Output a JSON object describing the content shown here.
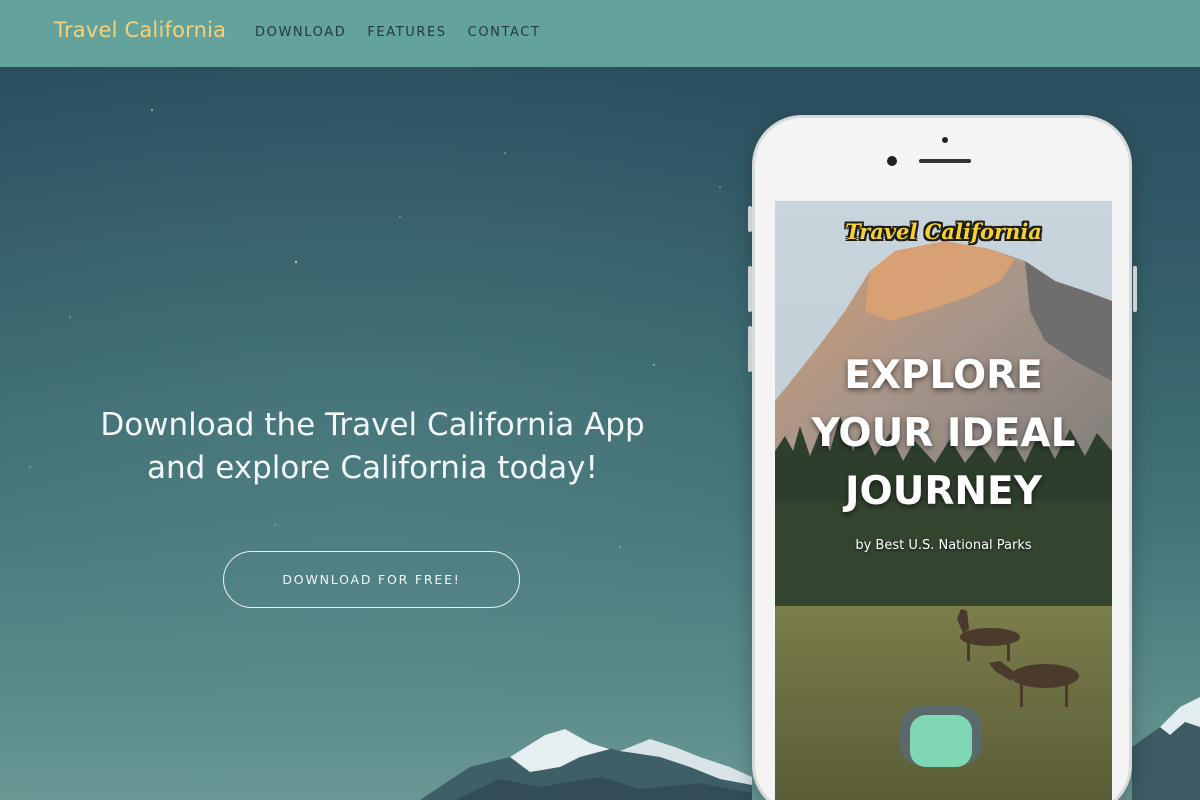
{
  "nav": {
    "brand": "Travel California",
    "links": [
      "DOWNLOAD",
      "FEATURES",
      "CONTACT"
    ]
  },
  "hero": {
    "heading_line1": "Download the Travel California App",
    "heading_line2": "and explore California today!",
    "button_label": "DOWNLOAD FOR FREE!"
  },
  "phone": {
    "app_logo": "Travel California",
    "headline_line1": "EXPLORE",
    "headline_line2": "YOUR IDEAL",
    "headline_line3": "JOURNEY",
    "subtitle": "by Best U.S. National Parks"
  },
  "colors": {
    "navbar": "#64a39c",
    "brand": "#f5d27a",
    "nav_link": "#243a3c",
    "hero_text": "#f2f6f6",
    "app_logo": "#f6d230",
    "app_button": "#7fd7b4"
  }
}
